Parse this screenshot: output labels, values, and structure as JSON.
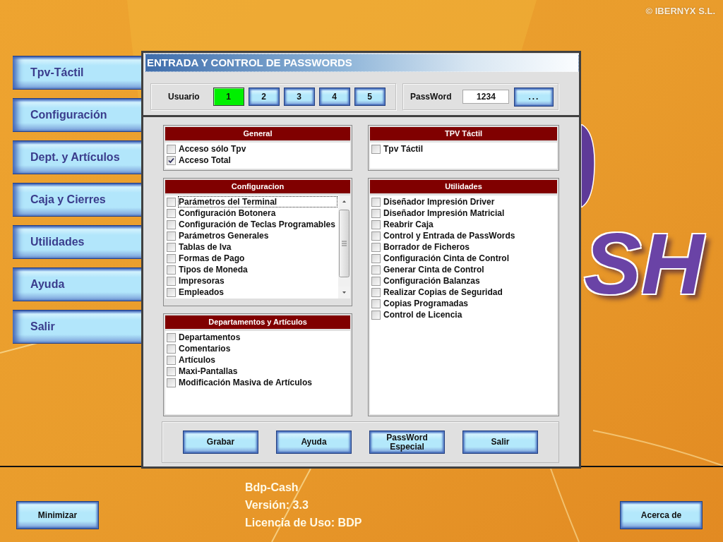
{
  "copyright": "© IBERNYX S.L.",
  "sidebar": {
    "items": [
      "Tpv-Táctil",
      "Configuración",
      "Dept. y Artículos",
      "Caja y Cierres",
      "Utilidades",
      "Ayuda",
      "Salir"
    ]
  },
  "dialog": {
    "title": "ENTRADA Y CONTROL DE PASSWORDS",
    "user_group": {
      "label": "Usuario",
      "users": [
        {
          "label": "1",
          "selected": true
        },
        {
          "label": "2",
          "selected": false
        },
        {
          "label": "3",
          "selected": false
        },
        {
          "label": "4",
          "selected": false
        },
        {
          "label": "5",
          "selected": false
        }
      ]
    },
    "password_group": {
      "label": "PassWord",
      "value": "1234",
      "button": "..."
    },
    "panels": [
      {
        "title": "General",
        "kind": "plain",
        "items": [
          {
            "label": "Acceso sólo Tpv",
            "checked": false
          },
          {
            "label": "Acceso Total",
            "checked": true
          }
        ]
      },
      {
        "title": "TPV Táctil",
        "kind": "plain",
        "items": [
          {
            "label": "Tpv Táctil",
            "checked": false
          }
        ]
      },
      {
        "title": "Configuracion",
        "kind": "scrolling",
        "items": [
          {
            "label": "Parámetros del Terminal",
            "checked": false,
            "focused": true
          },
          {
            "label": "Configuración Botonera",
            "checked": false,
            "focused": false
          },
          {
            "label": "Configuración de Teclas Programables",
            "checked": false,
            "focused": false
          },
          {
            "label": "Parámetros Generales",
            "checked": false,
            "focused": false
          },
          {
            "label": "Tablas de Iva",
            "checked": false,
            "focused": false
          },
          {
            "label": "Formas de Pago",
            "checked": false,
            "focused": false
          },
          {
            "label": "Tipos de Moneda",
            "checked": false,
            "focused": false
          },
          {
            "label": "Impresoras",
            "checked": false,
            "focused": false
          },
          {
            "label": "Empleados",
            "checked": false,
            "focused": false
          }
        ]
      },
      {
        "title": "Utilidades",
        "kind": "plain",
        "items": [
          {
            "label": "Diseñador Impresión Driver",
            "checked": false
          },
          {
            "label": "Diseñador Impresión Matricial",
            "checked": false
          },
          {
            "label": "Reabrir Caja",
            "checked": false
          },
          {
            "label": "Control y Entrada de PassWords",
            "checked": false
          },
          {
            "label": "Borrador de Ficheros",
            "checked": false
          },
          {
            "label": "Configuración Cinta de Control",
            "checked": false
          },
          {
            "label": "Generar Cinta de Control",
            "checked": false
          },
          {
            "label": "Configuración Balanzas",
            "checked": false
          },
          {
            "label": "Realizar Copias de Seguridad",
            "checked": false
          },
          {
            "label": "Copias Programadas",
            "checked": false
          },
          {
            "label": "Control de Licencia",
            "checked": false
          }
        ]
      },
      {
        "title": "Departamentos y Artículos",
        "kind": "plain",
        "items": [
          {
            "label": "Departamentos",
            "checked": false
          },
          {
            "label": "Comentarios",
            "checked": false
          },
          {
            "label": "Artículos",
            "checked": false
          },
          {
            "label": "Maxi-Pantallas",
            "checked": false
          },
          {
            "label": "Modificación Masiva de Artículos",
            "checked": false
          }
        ]
      }
    ],
    "buttons": [
      "Grabar",
      "Ayuda",
      "PassWord Especial",
      "Salir"
    ]
  },
  "background_logo": {
    "text": "SH"
  },
  "footer": {
    "left_button": "Minimizar",
    "product_info": [
      "Bdp-Cash",
      "Versión: 3.3",
      "Licencia de Uso: BDP"
    ],
    "right_button": "Acerca de"
  }
}
